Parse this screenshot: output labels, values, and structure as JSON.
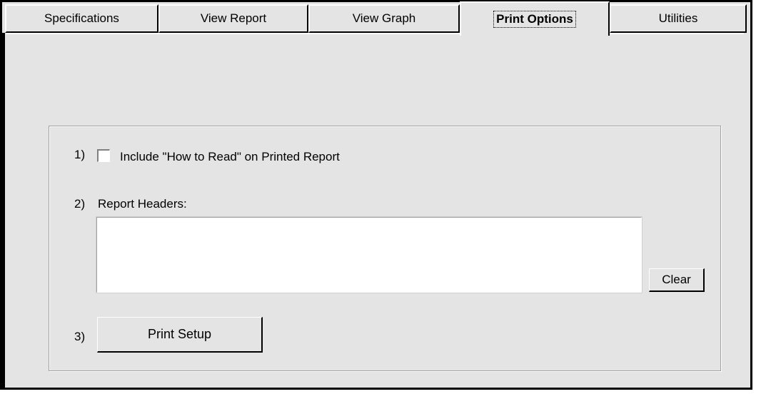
{
  "tabs": [
    {
      "label": "Specifications"
    },
    {
      "label": "View Report"
    },
    {
      "label": "View Graph"
    },
    {
      "label": "Print Options"
    },
    {
      "label": "Utilities"
    }
  ],
  "options": {
    "step1_num": "1)",
    "step1_label": "Include \"How to Read\" on Printed Report",
    "step1_checked": false,
    "step2_num": "2)",
    "step2_label": "Report Headers:",
    "report_headers_value": "",
    "clear_label": "Clear",
    "step3_num": "3)",
    "print_setup_label": "Print Setup"
  }
}
